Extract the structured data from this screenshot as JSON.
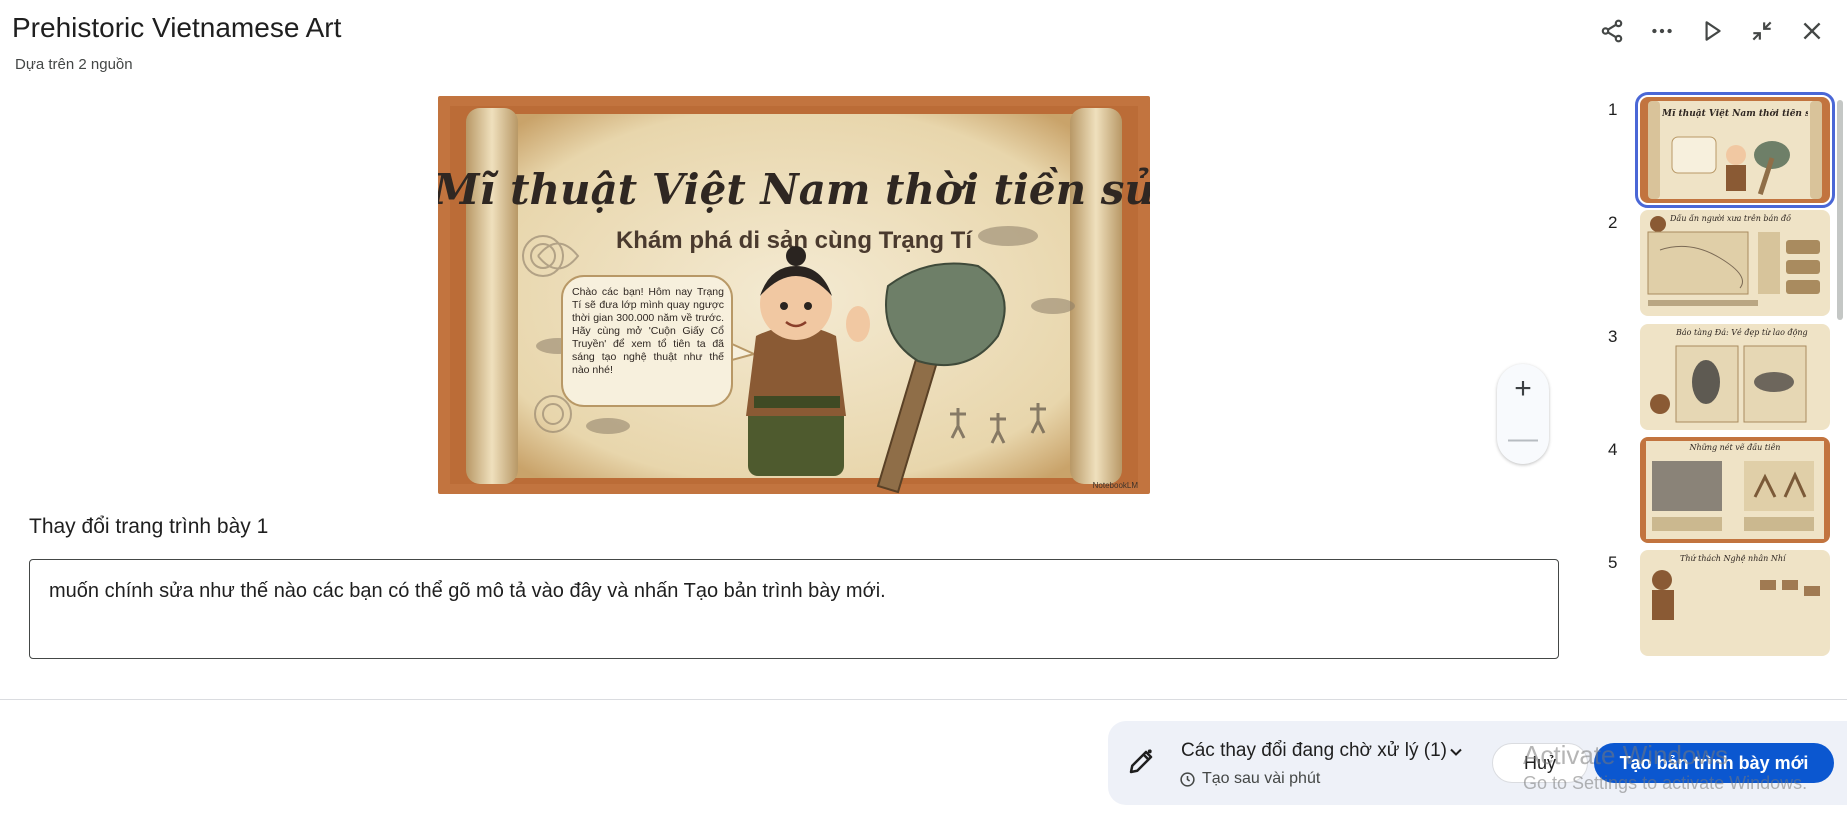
{
  "header": {
    "title": "Prehistoric Vietnamese Art",
    "subtitle": "Dựa trên 2 nguồn"
  },
  "toolbar": {
    "share_icon": "share-icon",
    "more_icon": "more-horizontal-icon",
    "play_icon": "play-icon",
    "collapse_icon": "collapse-icon",
    "close_icon": "close-icon"
  },
  "slide": {
    "title": "Mĩ thuật Việt Nam thời tiền sử",
    "subtitle": "Khám phá di sản cùng Trạng Tí",
    "bubble": "Chào các bạn! Hôm nay Trạng Tí sẽ đưa lớp mình quay ngược thời gian 300.000 năm về trước. Hãy cùng mở 'Cuộn Giấy Cổ Truyền' để xem tổ tiên ta đã sáng tạo nghệ thuật như thế nào nhé!",
    "credit": "NotebookLM"
  },
  "zoom": {
    "in_label": "+",
    "out_label": "—"
  },
  "editor": {
    "label": "Thay đổi trang trình bày 1",
    "prompt_value": "muốn chính sửa như thế nào các bạn có thể gõ mô tả vào đây và nhấn Tạo bản trình bày mới."
  },
  "thumbnails": [
    {
      "num": "1",
      "caption": "Mĩ thuật Việt Nam thời tiền sử"
    },
    {
      "num": "2",
      "caption": "Dấu ấn người xưa trên bản đồ"
    },
    {
      "num": "3",
      "caption": "Bảo tàng Đá: Vẻ đẹp từ lao động"
    },
    {
      "num": "4",
      "caption": "Những nét vẽ đầu tiên"
    },
    {
      "num": "5",
      "caption": "Thử thách Nghệ nhân Nhí"
    }
  ],
  "footer": {
    "pending": "Các thay đổi đang chờ xử lý (1)",
    "eta": "Tạo sau vài phút",
    "cancel": "Huỷ",
    "create": "Tạo bản trình bày mới",
    "watermark_title": "Activate Windows",
    "watermark_sub": "Go to Settings to activate Windows."
  },
  "colors": {
    "accent": "#0b57d0",
    "selected_outline": "#4a67d6",
    "parchment": "#efe3c6",
    "frame": "#c2743f"
  }
}
